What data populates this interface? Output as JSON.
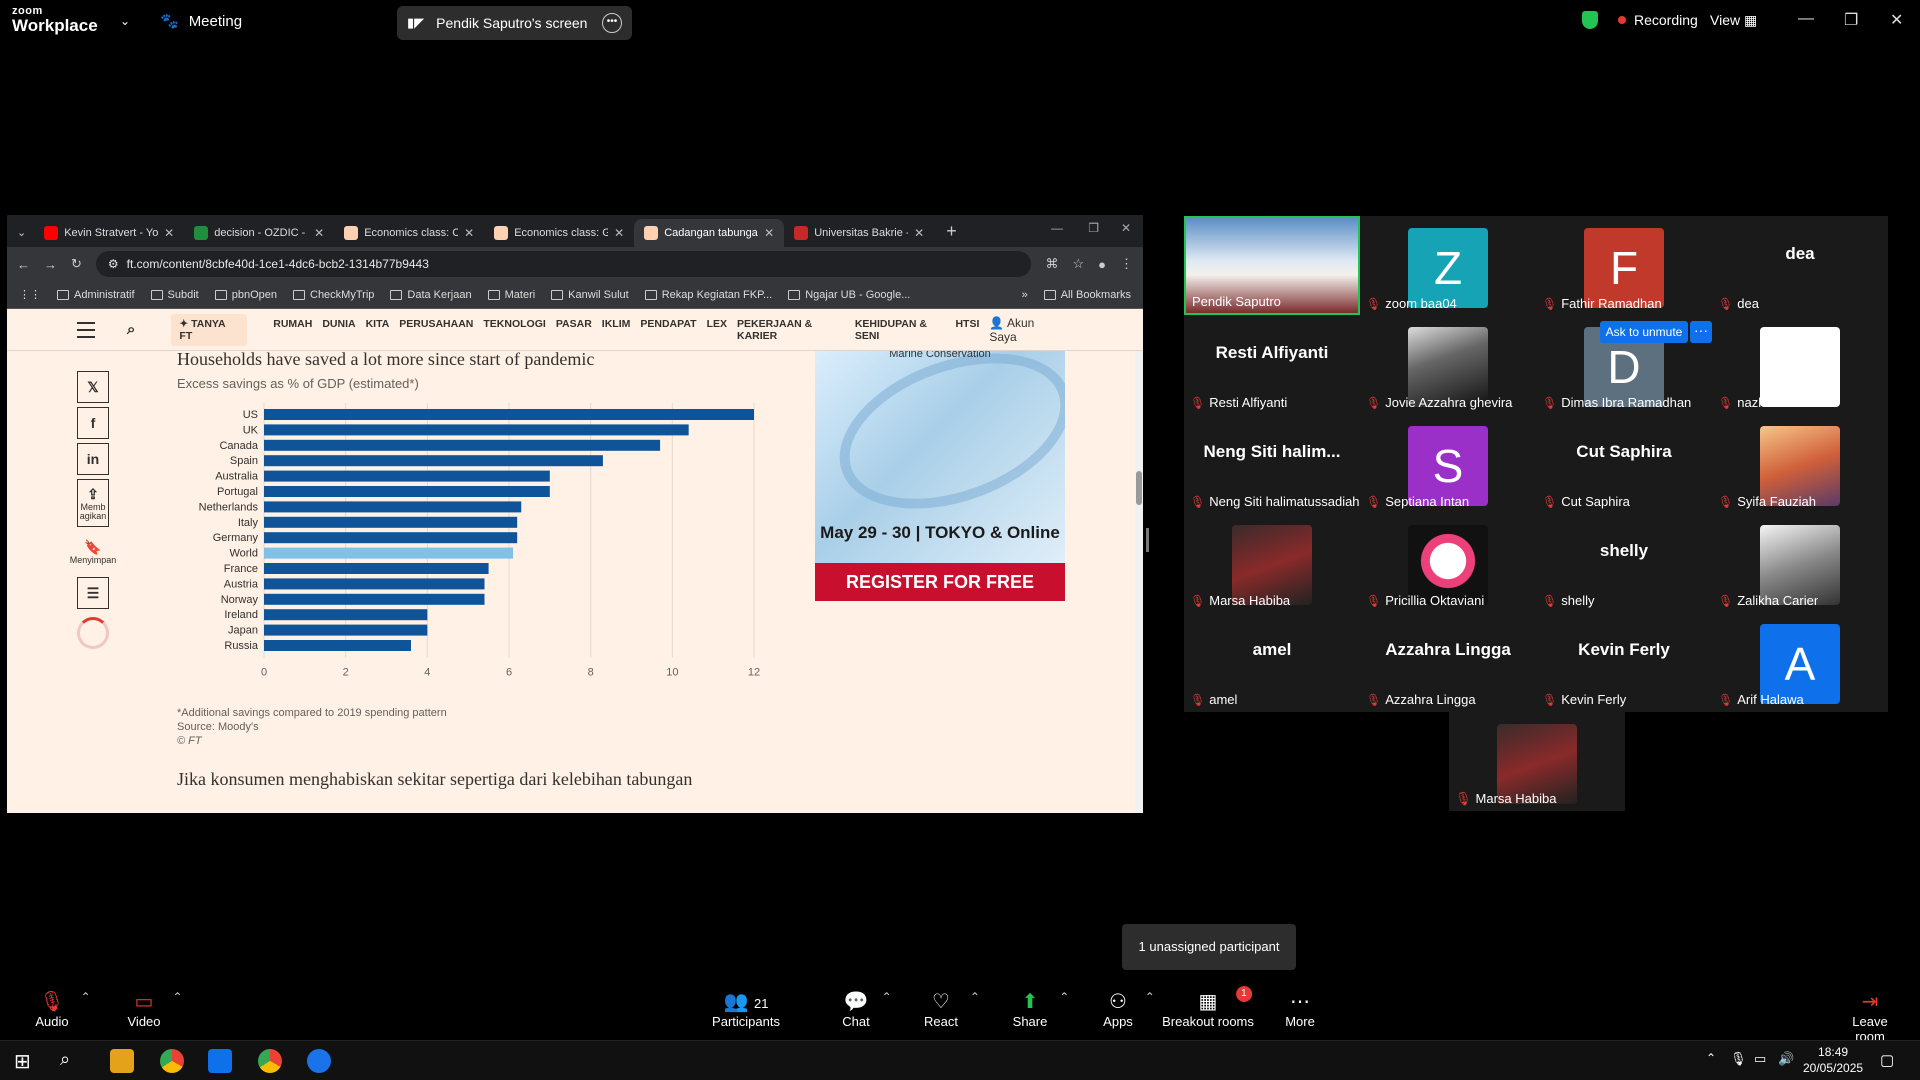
{
  "zoom": {
    "logo_line1": "zoom",
    "logo_line2": "Workplace",
    "meeting_label": "Meeting",
    "share_label": "Pendik Saputro's screen",
    "recording_label": "Recording",
    "view_label": "View"
  },
  "browser": {
    "tabs": [
      {
        "label": "Kevin Stratvert - YouT",
        "color": "#ff0000"
      },
      {
        "label": "decision - OZDIC - En",
        "color": "#1e8e3e"
      },
      {
        "label": "Economics class: Chin",
        "color": "#fcd0b1"
      },
      {
        "label": "Economics class: Glo",
        "color": "#fcd0b1"
      },
      {
        "label": "Cadangan tabungan",
        "color": "#fcd0b1"
      },
      {
        "label": "Universitas Bakrie - S",
        "color": "#c62828"
      }
    ],
    "url": "ft.com/content/8cbfe40d-1ce1-4dc6-bcb2-1314b77b9443",
    "bookmarks": [
      "Administratif",
      "Subdit",
      "pbnOpen",
      "CheckMyTrip",
      "Data Kerjaan",
      "Materi",
      "Kanwil Sulut",
      "Rekap Kegiatan FKP...",
      "Ngajar UB - Google..."
    ],
    "all_bookmarks": "All Bookmarks"
  },
  "ft": {
    "tanya": "TANYA FT",
    "nav": [
      "RUMAH",
      "DUNIA",
      "KITA",
      "PERUSAHAAN",
      "TEKNOLOGI",
      "PASAR",
      "IKLIM",
      "PENDAPAT",
      "LEX",
      "PEKERJAAN & KARIER",
      "KEHIDUPAN & SENI",
      "HTSI"
    ],
    "account": "Akun Saya",
    "share_label": "Memb agikan",
    "save_label": "Menyimpan",
    "chart_title": "Households have saved a lot more since start of pandemic",
    "chart_subtitle": "Excess savings as % of GDP (estimated*)",
    "footnote": "*Additional savings compared to 2019 spending pattern",
    "source": "Source: Moody's",
    "copyright": "© FT",
    "paragraph": "Jika konsumen menghabiskan sekitar sepertiga dari kelebihan tabungan",
    "ad_top": "Marine Conservation",
    "ad_date": "May 29 - 30 | TOKYO & Online",
    "ad_cta": "REGISTER FOR FREE"
  },
  "chart_data": {
    "type": "bar",
    "orientation": "horizontal",
    "title": "Households have saved a lot more since start of pandemic",
    "subtitle": "Excess savings as % of GDP (estimated*)",
    "categories": [
      "US",
      "UK",
      "Canada",
      "Spain",
      "Australia",
      "Portugal",
      "Netherlands",
      "Italy",
      "Germany",
      "World",
      "France",
      "Austria",
      "Norway",
      "Ireland",
      "Japan",
      "Russia"
    ],
    "values": [
      12.0,
      10.4,
      9.7,
      8.3,
      7.0,
      7.0,
      6.3,
      6.2,
      6.2,
      6.1,
      5.5,
      5.4,
      5.4,
      4.0,
      4.0,
      3.6
    ],
    "highlight": "World",
    "xlim": [
      0,
      12
    ],
    "xticks": [
      0,
      2,
      4,
      6,
      8,
      10,
      12
    ],
    "colors": {
      "bar": "#0f5499",
      "highlight": "#7fc2e6"
    }
  },
  "participants": [
    {
      "name": "Pendik Saputro",
      "type": "photo",
      "self": true
    },
    {
      "name": "zoom baa04",
      "type": "letter",
      "letter": "Z",
      "color": "#16a3b6"
    },
    {
      "name": "Fathir Ramadhan",
      "type": "letter",
      "letter": "F",
      "color": "#c0392b"
    },
    {
      "name": "dea",
      "type": "text",
      "display": "dea"
    },
    {
      "name": "Resti Alfiyanti",
      "type": "text",
      "display": "Resti Alfiyanti"
    },
    {
      "name": "Jovie Azzahra ghevira",
      "type": "photo-dark"
    },
    {
      "name": "Dimas Ibra Ramadhan",
      "type": "letter",
      "letter": "D",
      "color": "#5c7080"
    },
    {
      "name": "nazhira faiza",
      "type": "white"
    },
    {
      "name": "Neng Siti halimatussadiah",
      "type": "text",
      "display": "Neng Siti halim..."
    },
    {
      "name": "Septiana Intan",
      "type": "letter",
      "letter": "S",
      "color": "#9b30c8"
    },
    {
      "name": "Cut Saphira",
      "type": "text",
      "display": "Cut Saphira"
    },
    {
      "name": "Syifa Fauziah",
      "type": "photo-warm"
    },
    {
      "name": "Marsa Habiba",
      "type": "photo-red"
    },
    {
      "name": "Pricillia Oktaviani",
      "type": "photo-pink"
    },
    {
      "name": "shelly",
      "type": "text",
      "display": "shelly"
    },
    {
      "name": "Zalikha Carier",
      "type": "photo-gray"
    },
    {
      "name": "amel",
      "type": "text",
      "display": "amel"
    },
    {
      "name": "Azzahra Lingga",
      "type": "text",
      "display": "Azzahra Lingga"
    },
    {
      "name": "Kevin Ferly",
      "type": "text",
      "display": "Kevin Ferly"
    },
    {
      "name": "Arif Halawa",
      "type": "letter",
      "letter": "A",
      "color": "#0e71eb"
    }
  ],
  "extra_participant": "Marsa Habiba",
  "ask_unmute": "Ask to unmute",
  "unassigned": "1 unassigned participant",
  "toolbar": {
    "audio": "Audio",
    "video": "Video",
    "participants": "Participants",
    "participants_count": "21",
    "chat": "Chat",
    "react": "React",
    "share": "Share",
    "apps": "Apps",
    "breakout": "Breakout rooms",
    "breakout_badge": "1",
    "more": "More",
    "leave": "Leave room"
  },
  "taskbar": {
    "time": "18:49",
    "date": "20/05/2025"
  }
}
